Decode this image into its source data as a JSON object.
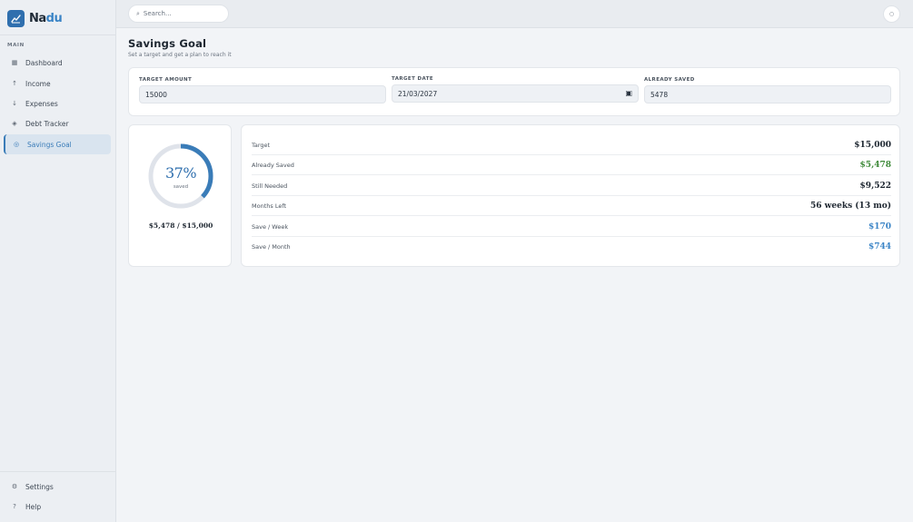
{
  "brand": {
    "name_part1": "Na",
    "name_part2": "du",
    "logo_icon": "trend-chart-icon",
    "accent": "#3a84c6"
  },
  "sidebar": {
    "section_label": "MAIN",
    "items": [
      {
        "label": "Dashboard",
        "icon": "grid-icon",
        "glyph": "▦"
      },
      {
        "label": "Income",
        "icon": "arrow-up-icon",
        "glyph": "↑"
      },
      {
        "label": "Expenses",
        "icon": "arrow-down-icon",
        "glyph": "↓"
      },
      {
        "label": "Debt Tracker",
        "icon": "diamond-icon",
        "glyph": "◈"
      },
      {
        "label": "Savings Goal",
        "icon": "target-icon",
        "glyph": "◎",
        "active": true
      }
    ],
    "footer_items": [
      {
        "label": "Settings",
        "icon": "gear-icon",
        "glyph": "⚙"
      },
      {
        "label": "Help",
        "icon": "question-icon",
        "glyph": "?"
      }
    ]
  },
  "topbar": {
    "search_placeholder": "Search...",
    "search_glyph": "⌕",
    "user_glyph": "○"
  },
  "page": {
    "title": "Savings Goal",
    "subtitle": "Set a target and get a plan to reach it"
  },
  "inputs": {
    "target_amount": {
      "label": "TARGET AMOUNT",
      "value": "15000"
    },
    "target_date": {
      "label": "TARGET DATE",
      "value": "21/03/2027",
      "glyph": "▣"
    },
    "already_saved": {
      "label": "ALREADY SAVED",
      "value": "5478"
    }
  },
  "progress": {
    "percent_label": "37%",
    "fraction": 0.37,
    "sub_label": "saved",
    "total_label": "$5,478 / $15,000",
    "ring_color": "#3a7cb8",
    "track_color": "#dfe3ea"
  },
  "stats": [
    {
      "label": "Target",
      "value": "$15,000",
      "tone": "default"
    },
    {
      "label": "Already Saved",
      "value": "$5,478",
      "tone": "green"
    },
    {
      "label": "Still Needed",
      "value": "$9,522",
      "tone": "default"
    },
    {
      "label": "Months Left",
      "value": "56 weeks (13 mo)",
      "tone": "default"
    },
    {
      "label": "Save / Week",
      "value": "$170",
      "tone": "blue"
    },
    {
      "label": "Save / Month",
      "value": "$744",
      "tone": "blue"
    }
  ],
  "colors": {
    "green": "#3f8a3a",
    "blue": "#3a84c6",
    "active_bg": "#d9e4ef"
  }
}
